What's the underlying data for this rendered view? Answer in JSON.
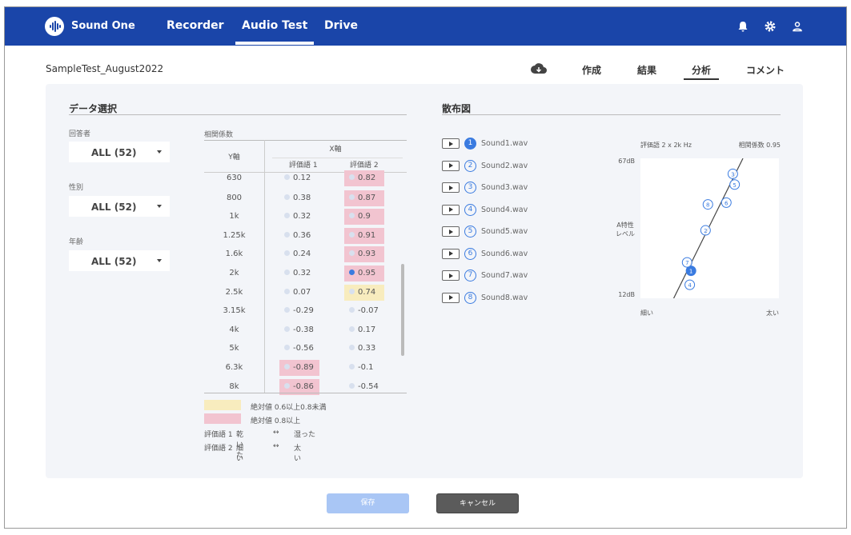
{
  "header": {
    "brand": "Sound One",
    "nav": [
      {
        "label": "Recorder"
      },
      {
        "label": "Audio Test",
        "active": true
      },
      {
        "label": "Drive"
      }
    ],
    "icons": [
      "bell-icon",
      "gear-icon",
      "user-icon"
    ],
    "color": "#1a45a9"
  },
  "subheader": {
    "file_name": "SampleTest_August2022",
    "cloud_icon": "cloud-download-icon",
    "tabs": [
      {
        "label": "作成"
      },
      {
        "label": "結果"
      },
      {
        "label": "分析",
        "active": true
      },
      {
        "label": "コメント"
      }
    ]
  },
  "data_select": {
    "title": "データ選択",
    "filters": [
      {
        "label": "回答者",
        "value": "ALL (52)"
      },
      {
        "label": "性別",
        "value": "ALL (52)"
      },
      {
        "label": "年齢",
        "value": "ALL (52)"
      }
    ]
  },
  "correlation": {
    "title": "相関係数",
    "y_header": "Y軸",
    "x_header": "X軸",
    "col1": "評価語 1",
    "col2": "評価語 2",
    "rows": [
      {
        "y": "630",
        "v1": "0.12",
        "v2": "0.82",
        "h1": "",
        "h2": "pink"
      },
      {
        "y": "800",
        "v1": "0.38",
        "v2": "0.87",
        "h1": "",
        "h2": "pink"
      },
      {
        "y": "1k",
        "v1": "0.32",
        "v2": "0.9",
        "h1": "",
        "h2": "pink"
      },
      {
        "y": "1.25k",
        "v1": "0.36",
        "v2": "0.91",
        "h1": "",
        "h2": "pink"
      },
      {
        "y": "1.6k",
        "v1": "0.24",
        "v2": "0.93",
        "h1": "",
        "h2": "pink"
      },
      {
        "y": "2k",
        "v1": "0.32",
        "v2": "0.95",
        "h1": "",
        "h2": "pink",
        "sel2": true
      },
      {
        "y": "2.5k",
        "v1": "0.07",
        "v2": "0.74",
        "h1": "",
        "h2": "yellow"
      },
      {
        "y": "3.15k",
        "v1": "-0.29",
        "v2": "-0.07",
        "h1": "",
        "h2": ""
      },
      {
        "y": "4k",
        "v1": "-0.38",
        "v2": "0.17",
        "h1": "",
        "h2": ""
      },
      {
        "y": "5k",
        "v1": "-0.56",
        "v2": "0.33",
        "h1": "",
        "h2": ""
      },
      {
        "y": "6.3k",
        "v1": "-0.89",
        "v2": "-0.1",
        "h1": "pink",
        "h2": ""
      },
      {
        "y": "8k",
        "v1": "-0.86",
        "v2": "-0.54",
        "h1": "pink",
        "h2": ""
      }
    ],
    "legend": {
      "yellow": "絶対値 0.6以上0.8未満",
      "pink": "絶対値 0.8以上",
      "word1": {
        "label": "評価語 1",
        "left": "乾いた",
        "arrow": "↔",
        "right": "湿った"
      },
      "word2": {
        "label": "評価語 2",
        "left": "細い",
        "arrow": "↔",
        "right": "太い"
      }
    },
    "colors": {
      "pink": "#f2c4d0",
      "yellow": "#f8ecbe"
    }
  },
  "scatter": {
    "title": "散布図",
    "sounds": [
      {
        "n": "1",
        "name": "Sound1.wav",
        "selected": true
      },
      {
        "n": "2",
        "name": "Sound2.wav"
      },
      {
        "n": "3",
        "name": "Sound3.wav"
      },
      {
        "n": "4",
        "name": "Sound4.wav"
      },
      {
        "n": "5",
        "name": "Sound5.wav"
      },
      {
        "n": "6",
        "name": "Sound6.wav"
      },
      {
        "n": "7",
        "name": "Sound7.wav"
      },
      {
        "n": "8",
        "name": "Sound8.wav"
      }
    ]
  },
  "chart_data": {
    "type": "scatter",
    "title": "評価語 2 x 2k Hz",
    "subtitle": "相関係数 0.95",
    "ylabel": "A特性\nレベル",
    "ylim": [
      12,
      67
    ],
    "ytick_labels": [
      "67dB",
      "12dB"
    ],
    "xlim": [
      0,
      1
    ],
    "xtick_labels": [
      "細い",
      "太い"
    ],
    "points": [
      {
        "label": "1",
        "x": 0.365,
        "y": 22.8,
        "selected": true
      },
      {
        "label": "2",
        "x": 0.47,
        "y": 38.7
      },
      {
        "label": "3",
        "x": 0.667,
        "y": 60.9
      },
      {
        "label": "4",
        "x": 0.356,
        "y": 17.3
      },
      {
        "label": "5",
        "x": 0.68,
        "y": 56.7
      },
      {
        "label": "6",
        "x": 0.62,
        "y": 49.6
      },
      {
        "label": "7",
        "x": 0.337,
        "y": 26.1
      },
      {
        "label": "8",
        "x": 0.487,
        "y": 48.9
      }
    ],
    "fit_line": [
      {
        "x": 0.24,
        "y": 12
      },
      {
        "x": 0.74,
        "y": 67
      }
    ]
  },
  "footer": {
    "save": "保存",
    "cancel": "キャンセル",
    "save_color": "#a9c6f5",
    "cancel_color": "#5b5b5b"
  }
}
